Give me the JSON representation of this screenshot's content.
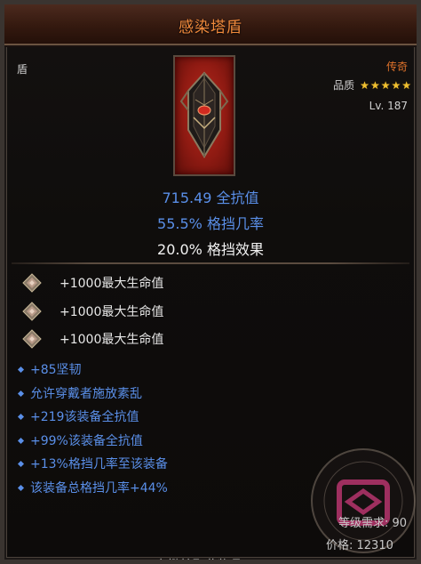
{
  "tooltip": {
    "title": "感染塔盾",
    "item_type": "盾",
    "rarity": "传奇",
    "quality_label": "品质",
    "quality_stars": 5,
    "level": "Lv. 187",
    "main_stats": [
      "715.49 全抗值",
      "55.5% 格挡几率",
      "20.0% 格挡效果"
    ],
    "gem_stats": [
      "+1000最大生命值",
      "+1000最大生命值",
      "+1000最大生命值"
    ],
    "affixes": [
      "+85坚韧",
      "允许穿戴者施放素乱",
      "+219该装备全抗值",
      "+99%该装备全抗值",
      "+13%格挡几率至该装备",
      "该装备总格挡几率+44%"
    ],
    "requirement": "等级需求: 90",
    "price": "价格: 12310",
    "bottom_hint": "右键拾取此物品"
  },
  "colors": {
    "title": "#f08a3c",
    "rarity": "#e0722a",
    "magic_blue": "#5a8fe8",
    "star": "#f0c030"
  },
  "icons": {
    "item": "tower-shield-icon",
    "gem": "amethyst-gem-icon",
    "star": "star-icon",
    "watermark": "watermark-logo"
  }
}
